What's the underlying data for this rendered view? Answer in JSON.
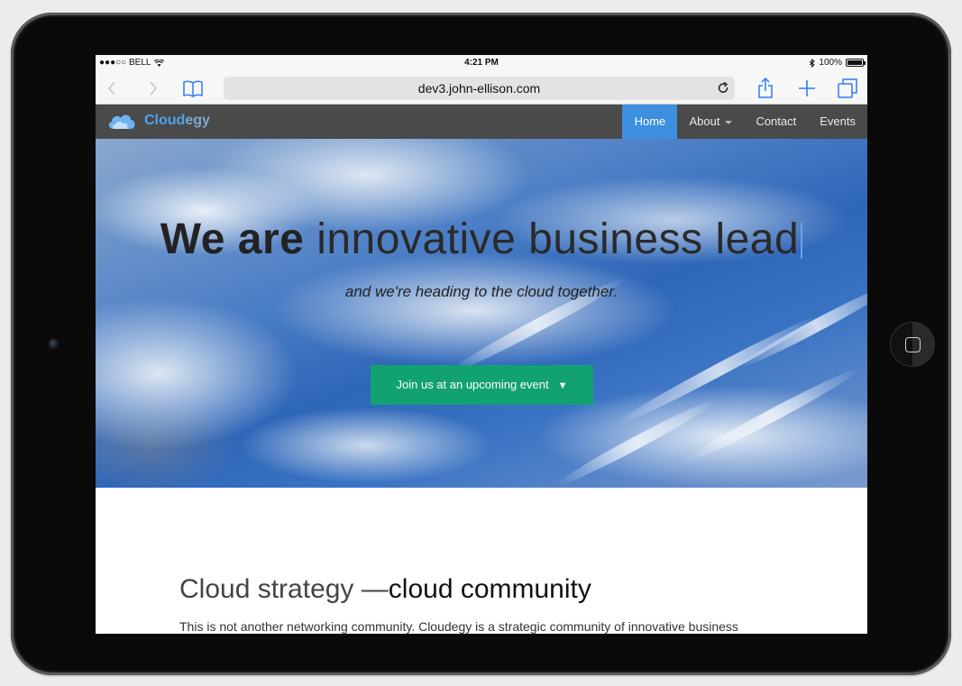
{
  "status_bar": {
    "carrier": "●●●○○ BELL",
    "time": "4:21 PM",
    "battery": "100%"
  },
  "browser": {
    "url": "dev3.john-ellison.com"
  },
  "site": {
    "brand_part1": "Cloud",
    "brand_part2": "egy",
    "nav": [
      {
        "label": "Home",
        "active": true
      },
      {
        "label": "About",
        "dropdown": true
      },
      {
        "label": "Contact"
      },
      {
        "label": "Events"
      }
    ]
  },
  "hero": {
    "headline_strong": "We are",
    "headline_light": "innovative business lead",
    "subtitle": "and we're heading to the cloud together.",
    "cta_label": "Join us at an upcoming event",
    "cta_arrow": "▼"
  },
  "content": {
    "heading_light": "Cloud strategy —",
    "heading_dark": "cloud community",
    "body": "This is not another networking community. Cloudegy is a strategic community of innovative business"
  },
  "colors": {
    "nav_bg": "#4a4a4a",
    "nav_active": "#3d8fe0",
    "cta_bg": "#12a271",
    "brand": "#4da3ec"
  }
}
